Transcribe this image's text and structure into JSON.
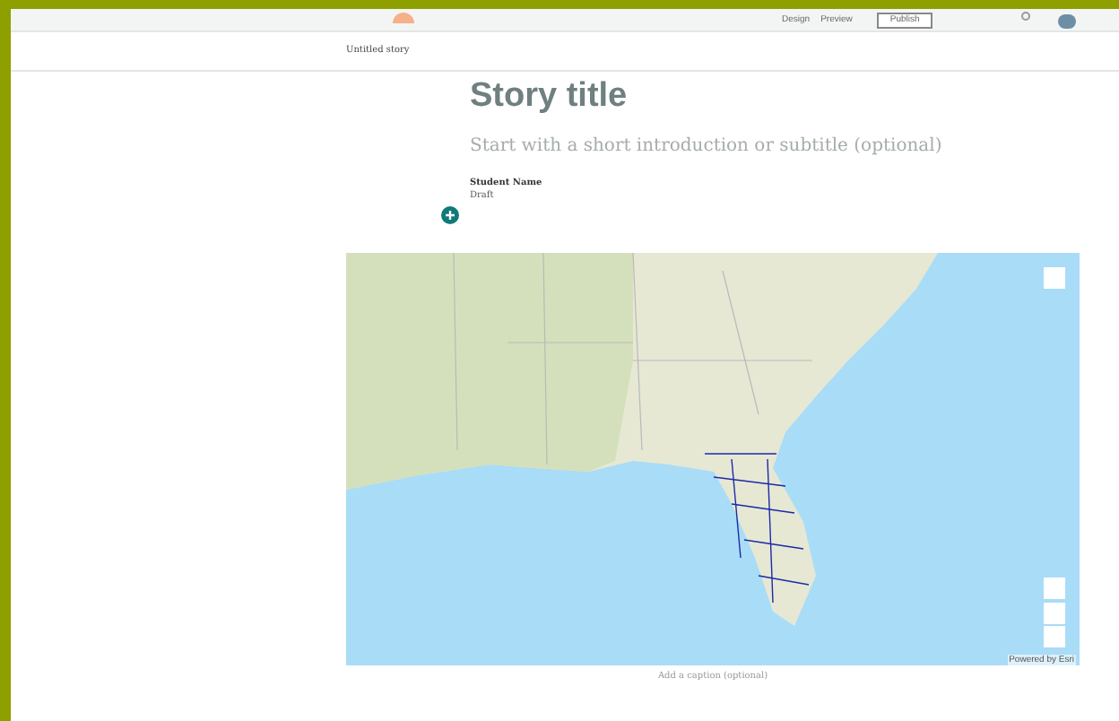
{
  "header": {
    "buttons": [
      {
        "label": "Design"
      },
      {
        "label": "Preview"
      }
    ],
    "publish": "Publish"
  },
  "breadcrumb": "Untitled story",
  "story": {
    "title": "Story title",
    "subtitle": "Start with a short introduction or subtitle (optional)",
    "author": "Student Name",
    "status": "Draft"
  },
  "map": {
    "credit": "Powered by Esri",
    "caption": "Add a caption (optional)"
  }
}
